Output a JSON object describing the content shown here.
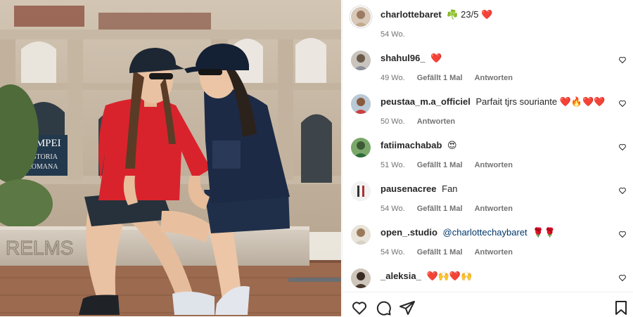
{
  "post": {
    "author": "charlottebaret",
    "caption": "☘️ 23/5 ❤️",
    "time": "54 Wo."
  },
  "comments": [
    {
      "user": "shahul96_",
      "text": "❤️",
      "mention": "",
      "time": "49 Wo.",
      "likes": "Gefällt 1 Mal",
      "reply": "Antworten"
    },
    {
      "user": "peustaa_m.a_officiel",
      "text": "Parfait tjrs souriante ❤️🔥❤️❤️",
      "mention": "",
      "time": "50 Wo.",
      "likes": "",
      "reply": "Antworten"
    },
    {
      "user": "fatiimachabab",
      "text": "😍",
      "mention": "",
      "time": "51 Wo.",
      "likes": "Gefällt 1 Mal",
      "reply": "Antworten"
    },
    {
      "user": "pausenacree",
      "text": "Fan",
      "mention": "",
      "time": "54 Wo.",
      "likes": "Gefällt 1 Mal",
      "reply": "Antworten"
    },
    {
      "user": "open_.studio",
      "text": "🌹🌹",
      "mention": "@charlottechaybaret",
      "time": "54 Wo.",
      "likes": "Gefällt 1 Mal",
      "reply": "Antworten"
    },
    {
      "user": "_aleksia_",
      "text": "❤️🙌❤️🙌",
      "mention": "",
      "time": "",
      "likes": "",
      "reply": ""
    }
  ],
  "photo": {
    "sign_line1": "OMPEI",
    "sign_line2": "STORIA",
    "sign_line3": "ROMANA",
    "graffiti": "RELMS"
  },
  "icons": {
    "like": "heart-outline-icon",
    "comment": "comment-bubble-icon",
    "share": "paper-plane-icon",
    "save": "bookmark-icon",
    "comment_like": "heart-outline-icon"
  },
  "colors": {
    "text": "#262626",
    "secondary": "#737373",
    "mention": "#00376b",
    "divider": "#efefef"
  }
}
